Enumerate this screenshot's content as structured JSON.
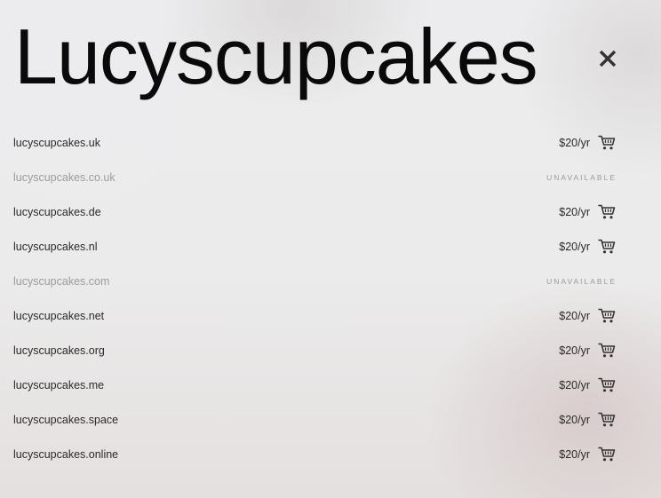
{
  "header": {
    "title": "Lucyscupcakes",
    "close_icon": "close-icon"
  },
  "domains": [
    {
      "name": "lucyscupcakes.uk",
      "available": true,
      "price": "$20/yr"
    },
    {
      "name": "lucyscupcakes.co.uk",
      "available": false,
      "status": "UNAVAILABLE"
    },
    {
      "name": "lucyscupcakes.de",
      "available": true,
      "price": "$20/yr"
    },
    {
      "name": "lucyscupcakes.nl",
      "available": true,
      "price": "$20/yr"
    },
    {
      "name": "lucyscupcakes.com",
      "available": false,
      "status": "UNAVAILABLE"
    },
    {
      "name": "lucyscupcakes.net",
      "available": true,
      "price": "$20/yr"
    },
    {
      "name": "lucyscupcakes.org",
      "available": true,
      "price": "$20/yr"
    },
    {
      "name": "lucyscupcakes.me",
      "available": true,
      "price": "$20/yr"
    },
    {
      "name": "lucyscupcakes.space",
      "available": true,
      "price": "$20/yr"
    },
    {
      "name": "lucyscupcakes.online",
      "available": true,
      "price": "$20/yr"
    }
  ],
  "icons": {
    "cart": "add-to-cart-icon"
  },
  "colors": {
    "text": "#1a1a1a",
    "muted": "#9c9c9c"
  }
}
